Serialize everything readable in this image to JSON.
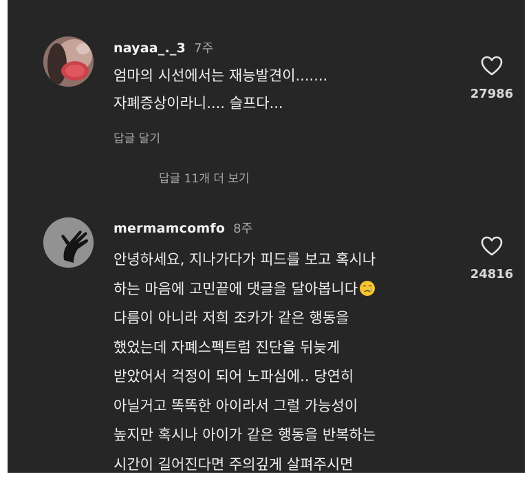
{
  "comments": [
    {
      "username": "nayaa_._3",
      "time": "7주",
      "lines": [
        "엄마의 시선에서는 재능발견이.......",
        "자폐증상이라니.... 슬프다..."
      ],
      "reply_label": "답글 달기",
      "likes": "27986",
      "icon": "heart-outline-icon"
    },
    {
      "username": "mermamcomfo",
      "time": "8주",
      "lines": [
        "안녕하세요, 지나가다가 피드를 보고 혹시나",
        "하는 마음에 고민끝에 댓글을 달아봅니다",
        "다름이 아니라 저희 조카가 같은 행동을",
        "했었는데 자폐스펙트럼 진단을 뒤늦게",
        "받았어서 걱정이 되어 노파심에.. 당연히",
        "아닐거고 똑똑한 아이라서 그럴 가능성이",
        "높지만 혹시나 아이가 같은 행동을 반복하는",
        "시간이 길어진다면 주의깊게 살펴주시면"
      ],
      "likes": "24816",
      "icon": "heart-outline-icon",
      "emoji": "crying-face-emoji"
    }
  ],
  "view_more_replies": "답글 11개 더 보기"
}
